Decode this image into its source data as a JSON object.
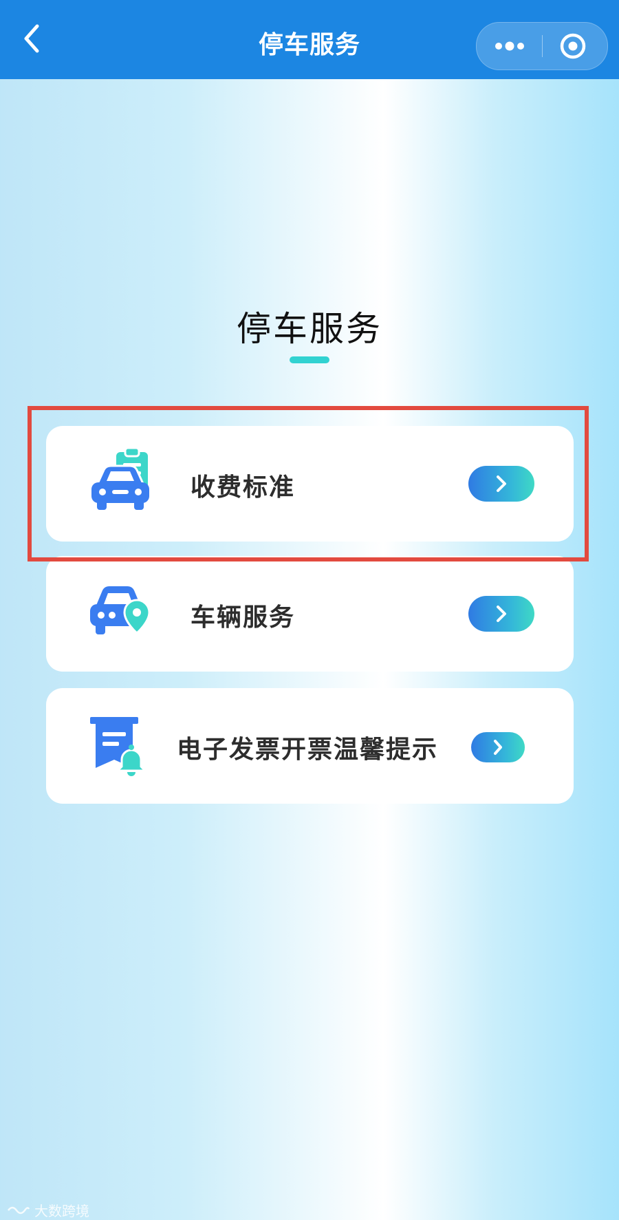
{
  "nav": {
    "title": "停车服务",
    "back_icon": "chevron-left-icon",
    "more_icon": "more-dots-icon",
    "target_icon": "target-icon"
  },
  "page": {
    "heading": "停车服务",
    "accent_color": "#31d2d1"
  },
  "items": [
    {
      "label": "收费标准",
      "icon": "car-clipboard-icon",
      "highlighted": true
    },
    {
      "label": "车辆服务",
      "icon": "car-location-icon",
      "highlighted": false
    },
    {
      "label": "电子发票开票温馨提示",
      "icon": "invoice-bell-icon",
      "highlighted": false
    }
  ],
  "colors": {
    "nav_bar": "#1c86e2",
    "highlight_border": "#e24a3f",
    "icon_blue": "#3a7df0",
    "icon_teal": "#3cd6c9"
  },
  "watermark": {
    "text": "大数跨境"
  }
}
